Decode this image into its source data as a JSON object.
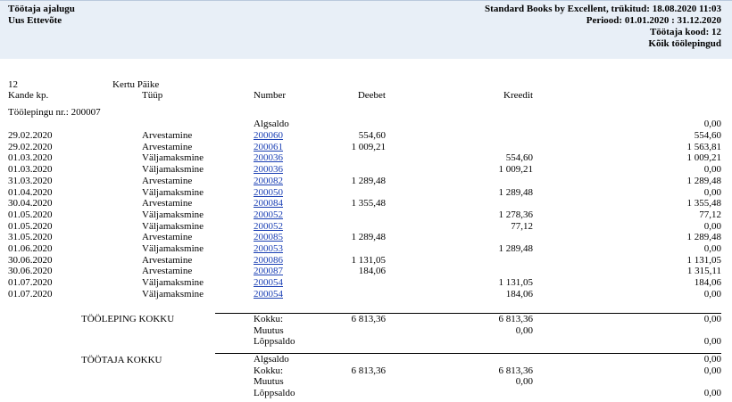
{
  "header": {
    "left": [
      "Töötaja ajalugu",
      "Uus Ettevõte"
    ],
    "right": [
      "Standard Books by Excellent, trükitud: 18.08.2020 11:03",
      "Periood: 01.01.2020 : 31.12.2020",
      "Töötaja kood: 12",
      "Kõik töölepingud"
    ]
  },
  "employee": {
    "code": "12",
    "name": "Kertu Päike"
  },
  "columns": {
    "date": "Kande kp.",
    "type": "Tüüp",
    "number": "Number",
    "debit": "Deebet",
    "credit": "Kreedit"
  },
  "contract_label": "Töölepingu nr.: 200007",
  "opening": {
    "label": "Algsaldo",
    "balance": "0,00"
  },
  "rows": [
    {
      "date": "29.02.2020",
      "type": "Arvestamine",
      "number": "200060",
      "debit": "554,60",
      "credit": "",
      "balance": "554,60"
    },
    {
      "date": "29.02.2020",
      "type": "Arvestamine",
      "number": "200061",
      "debit": "1 009,21",
      "credit": "",
      "balance": "1 563,81"
    },
    {
      "date": "01.03.2020",
      "type": "Väljamaksmine",
      "number": "200036",
      "debit": "",
      "credit": "554,60",
      "balance": "1 009,21"
    },
    {
      "date": "01.03.2020",
      "type": "Väljamaksmine",
      "number": "200036",
      "debit": "",
      "credit": "1 009,21",
      "balance": "0,00"
    },
    {
      "date": "31.03.2020",
      "type": "Arvestamine",
      "number": "200082",
      "debit": "1 289,48",
      "credit": "",
      "balance": "1 289,48"
    },
    {
      "date": "01.04.2020",
      "type": "Väljamaksmine",
      "number": "200050",
      "debit": "",
      "credit": "1 289,48",
      "balance": "0,00"
    },
    {
      "date": "30.04.2020",
      "type": "Arvestamine",
      "number": "200084",
      "debit": "1 355,48",
      "credit": "",
      "balance": "1 355,48"
    },
    {
      "date": "01.05.2020",
      "type": "Väljamaksmine",
      "number": "200052",
      "debit": "",
      "credit": "1 278,36",
      "balance": "77,12"
    },
    {
      "date": "01.05.2020",
      "type": "Väljamaksmine",
      "number": "200052",
      "debit": "",
      "credit": "77,12",
      "balance": "0,00"
    },
    {
      "date": "31.05.2020",
      "type": "Arvestamine",
      "number": "200085",
      "debit": "1 289,48",
      "credit": "",
      "balance": "1 289,48"
    },
    {
      "date": "01.06.2020",
      "type": "Väljamaksmine",
      "number": "200053",
      "debit": "",
      "credit": "1 289,48",
      "balance": "0,00"
    },
    {
      "date": "30.06.2020",
      "type": "Arvestamine",
      "number": "200086",
      "debit": "1 131,05",
      "credit": "",
      "balance": "1 131,05"
    },
    {
      "date": "30.06.2020",
      "type": "Arvestamine",
      "number": "200087",
      "debit": "184,06",
      "credit": "",
      "balance": "1 315,11"
    },
    {
      "date": "01.07.2020",
      "type": "Väljamaksmine",
      "number": "200054",
      "debit": "",
      "credit": "1 131,05",
      "balance": "184,06"
    },
    {
      "date": "01.07.2020",
      "type": "Väljamaksmine",
      "number": "200054",
      "debit": "",
      "credit": "184,06",
      "balance": "0,00"
    }
  ],
  "contract_total": {
    "title": "TÖÖLEPING KOKKU",
    "lines": [
      {
        "label": "Kokku:",
        "debit": "6 813,36",
        "credit": "6 813,36",
        "balance": "0,00"
      },
      {
        "label": "Muutus",
        "debit": "",
        "credit": "0,00",
        "balance": ""
      },
      {
        "label": "Lõppsaldo",
        "debit": "",
        "credit": "",
        "balance": "0,00"
      }
    ]
  },
  "employee_total": {
    "title": "TÖÖTAJA KOKKU",
    "lines": [
      {
        "label": "Algsaldo",
        "debit": "",
        "credit": "",
        "balance": "0,00"
      },
      {
        "label": "Kokku:",
        "debit": "6 813,36",
        "credit": "6 813,36",
        "balance": "0,00"
      },
      {
        "label": "Muutus",
        "debit": "",
        "credit": "0,00",
        "balance": ""
      },
      {
        "label": "Lõppsaldo",
        "debit": "",
        "credit": "",
        "balance": "0,00"
      }
    ]
  }
}
